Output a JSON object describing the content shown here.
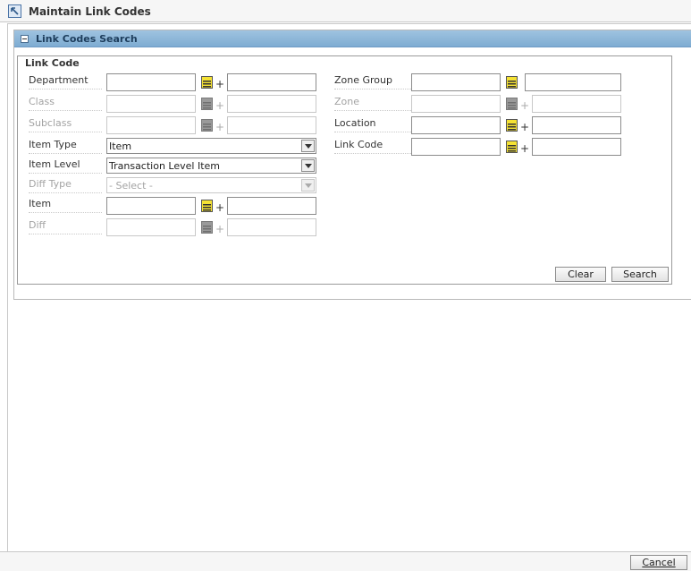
{
  "window": {
    "title": "Maintain Link Codes"
  },
  "panel": {
    "title": "Link Codes Search",
    "legend": "Link Code"
  },
  "left": {
    "department": {
      "label": "Department",
      "value": "",
      "to_value": ""
    },
    "class": {
      "label": "Class",
      "value": "",
      "to_value": ""
    },
    "subclass": {
      "label": "Subclass",
      "value": "",
      "to_value": ""
    },
    "item_type": {
      "label": "Item Type",
      "selected": "Item"
    },
    "item_level": {
      "label": "Item Level",
      "selected": "Transaction Level Item"
    },
    "diff_type": {
      "label": "Diff Type",
      "selected": "- Select -"
    },
    "item": {
      "label": "Item",
      "value": "",
      "to_value": ""
    },
    "diff": {
      "label": "Diff",
      "value": "",
      "to_value": ""
    }
  },
  "right": {
    "zone_group": {
      "label": "Zone Group",
      "value": "",
      "to_value": ""
    },
    "zone": {
      "label": "Zone",
      "value": "",
      "to_value": ""
    },
    "location": {
      "label": "Location",
      "value": "",
      "to_value": ""
    },
    "link_code": {
      "label": "Link Code",
      "value": "",
      "to_value": ""
    }
  },
  "buttons": {
    "clear": "Clear",
    "search": "Search",
    "cancel": "Cancel"
  },
  "plus_symbol": "+",
  "icons": {
    "lov": "list-lookup-icon",
    "collapse": "collapse-icon",
    "title": "navigate-back-icon"
  },
  "colors": {
    "header": "#8fb8db",
    "lov_yellow": "#f5e234"
  }
}
